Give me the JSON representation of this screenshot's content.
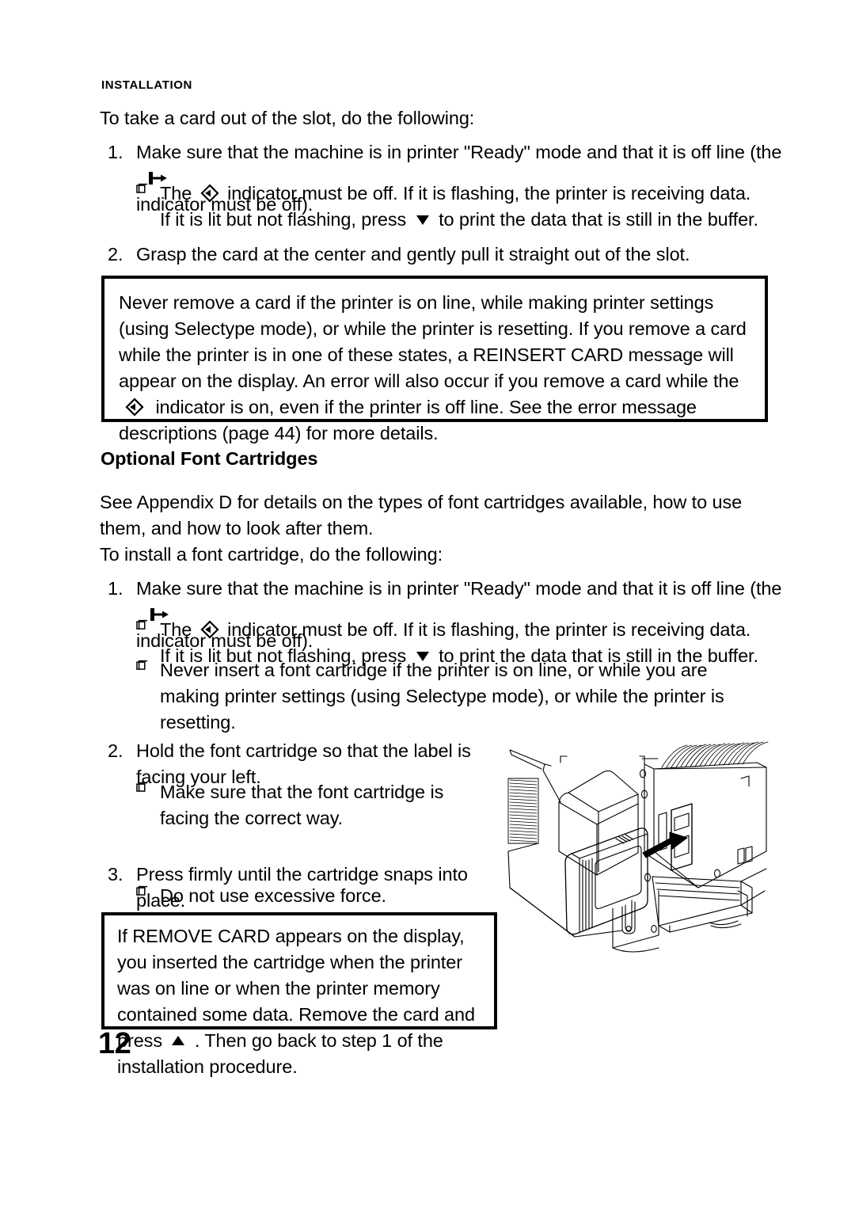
{
  "document": {
    "running_head": "INSTALLATION",
    "page_number": "12"
  },
  "icons": {
    "offline_indicator": "offline-arrow-icon",
    "data_indicator": "data-diamond-icon",
    "down_button": "down-triangle-icon",
    "up_button": "up-triangle-icon",
    "bullet": "box-bullet-icon"
  },
  "section_card": {
    "lead": "To take a card out of the slot, do the following:",
    "step1": {
      "num": "1.",
      "text_a": "Make sure that the machine is in printer \"Ready\" mode and that it is off line (the",
      "text_b": "indicator must be off).",
      "bullet1_a": "The",
      "bullet1_b": "indicator must be off. If it is flashing, the printer is receiving data. If it is lit but not flashing, press",
      "bullet1_c": "to print the data that is still in the buffer."
    },
    "step2": {
      "num": "2.",
      "text": "Grasp the card at the center and gently pull it straight out of the slot."
    },
    "warning": {
      "text_a": "Never remove a card if the printer is on line, while making printer settings (using Selectype mode), or while the printer is resetting. If you remove a card while the printer is in one of these states, a REINSERT CARD message will appear on the display. An error will also occur if you remove a card while the",
      "text_b": "indicator is on, even if the printer is off line. See the error message descriptions (page   44) for more details."
    }
  },
  "section_font": {
    "heading": "Optional Font Cartridges",
    "intro": "See Appendix D for details on the types of font cartridges available, how to use them, and how to look after them.",
    "lead": "To install a font cartridge, do the following:",
    "step1": {
      "num": "1.",
      "text_a": "Make sure that the machine is in printer \"Ready\" mode and that it is off line (the",
      "text_b": "indicator must be off).",
      "bullet1_a": "The",
      "bullet1_b": "indicator must be off. If it is flashing, the printer is receiving data. If it is lit but not flashing, press",
      "bullet1_c": "to print the data that is still in the buffer.",
      "bullet2": "Never insert a font cartridge if the printer is on line, or while you are making printer settings (using Selectype mode), or while the printer is resetting."
    },
    "step2": {
      "num": "2.",
      "text": "Hold the font cartridge so that the label is facing your left.",
      "bullet1": "Make sure that the font cartridge is facing the correct way."
    },
    "step3": {
      "num": "3.",
      "text": "Press firmly until the cartridge snaps into place.",
      "bullet1": "Do not use excessive force."
    },
    "warning": {
      "text_a": "If REMOVE CARD appears on the display, you inserted the cartridge when the printer was on line or when the printer memory contained some data. Remove the card and press",
      "text_b": ". Then go back to step 1 of the installation procedure."
    },
    "figure_caption": "font-cartridge-insertion-illustration"
  }
}
